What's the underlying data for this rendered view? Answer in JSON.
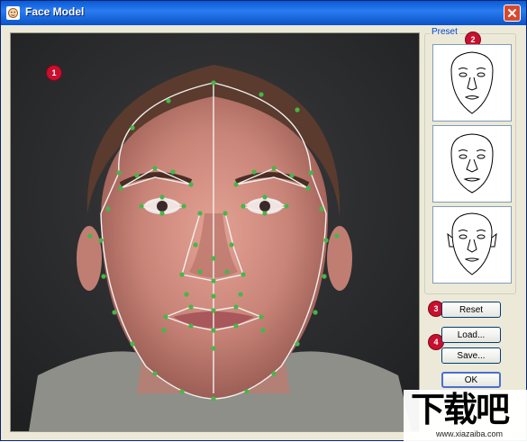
{
  "window": {
    "title": "Face Model",
    "accent": "#0a5ad6",
    "close_icon": "close-icon"
  },
  "markers": {
    "one": "1",
    "two": "2",
    "three": "3",
    "four": "4"
  },
  "presets": {
    "legend": "Preset",
    "thumbs": [
      "face-preset-1",
      "face-preset-2",
      "face-preset-3"
    ]
  },
  "buttons": {
    "reset": "Reset",
    "load": "Load...",
    "save": "Save...",
    "ok": "OK"
  },
  "watermark": {
    "text": "下载吧",
    "url": "www.xiazaiba.com"
  }
}
